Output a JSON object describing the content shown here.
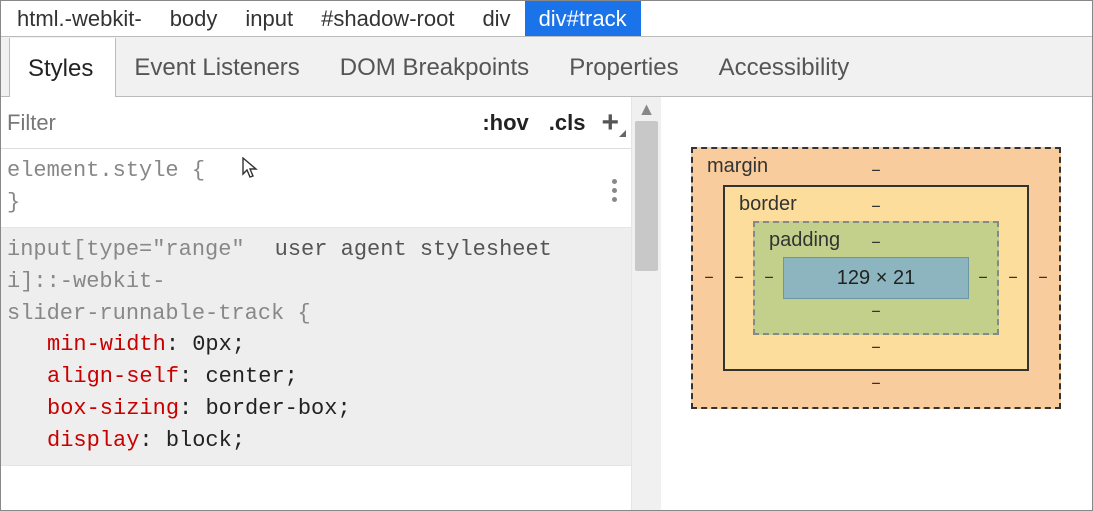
{
  "breadcrumb": [
    {
      "label": "html.-webkit-",
      "selected": false
    },
    {
      "label": "body",
      "selected": false
    },
    {
      "label": "input",
      "selected": false
    },
    {
      "label": "#shadow-root",
      "selected": false
    },
    {
      "label": "div",
      "selected": false
    },
    {
      "label": "div#track",
      "selected": true
    }
  ],
  "tabs": [
    {
      "label": "Styles",
      "active": true
    },
    {
      "label": "Event Listeners",
      "active": false
    },
    {
      "label": "DOM Breakpoints",
      "active": false
    },
    {
      "label": "Properties",
      "active": false
    },
    {
      "label": "Accessibility",
      "active": false
    }
  ],
  "filter": {
    "placeholder": "Filter",
    "hov": ":hov",
    "cls": ".cls"
  },
  "rules": {
    "element_style": {
      "selector": "element.style {",
      "close": "}"
    },
    "ua": {
      "selector_l1": "input[type=\"range\"",
      "ua_label": "user agent stylesheet",
      "selector_l2": "i]::-webkit-",
      "selector_l3": "slider-runnable-track {",
      "props": [
        {
          "name": "min-width",
          "value": "0px"
        },
        {
          "name": "align-self",
          "value": "center"
        },
        {
          "name": "box-sizing",
          "value": "border-box"
        },
        {
          "name": "display",
          "value": "block"
        }
      ]
    }
  },
  "box_model": {
    "margin": {
      "label": "margin",
      "top": "–",
      "right": "–",
      "bottom": "–",
      "left": "–"
    },
    "border": {
      "label": "border",
      "top": "–",
      "right": "–",
      "bottom": "–",
      "left": "–"
    },
    "padding": {
      "label": "padding",
      "top": "–",
      "right": "–",
      "bottom": "–",
      "left": "–"
    },
    "content": "129 × 21"
  }
}
